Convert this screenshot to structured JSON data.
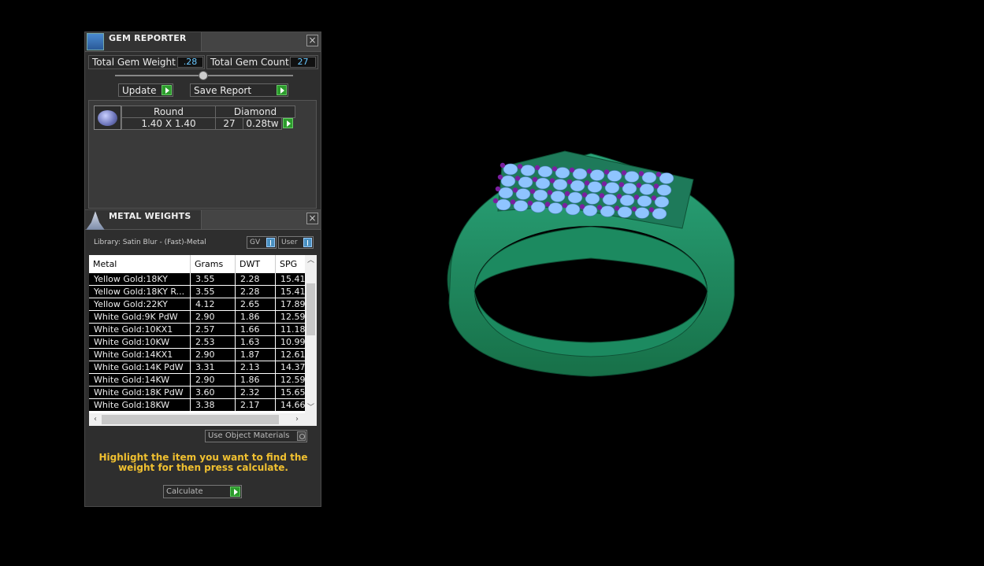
{
  "gem_reporter": {
    "title": "GEM REPORTER",
    "close": "×",
    "total_weight_label": "Total Gem Weight",
    "total_weight_value": ".28",
    "total_count_label": "Total Gem Count",
    "total_count_value": "27",
    "update_label": "Update",
    "save_report_label": "Save Report",
    "gem": {
      "shape": "Round",
      "material": "Diamond",
      "size": "1.40 X 1.40",
      "count": "27",
      "weight": "0.28tw"
    }
  },
  "metal_weights": {
    "title": "METAL WEIGHTS",
    "close": "×",
    "library": "Library: Satin Blur - (Fast)-Metal",
    "gv_label": "GV",
    "user_label": "User",
    "columns": [
      "Metal",
      "Grams",
      "DWT",
      "SPG"
    ],
    "rows": [
      [
        "Yellow Gold:18KY",
        "3.55",
        "2.28",
        "15.41"
      ],
      [
        "Yellow Gold:18KY R...",
        "3.55",
        "2.28",
        "15.41"
      ],
      [
        "Yellow Gold:22KY",
        "4.12",
        "2.65",
        "17.89"
      ],
      [
        "White Gold:9K PdW",
        "2.90",
        "1.86",
        "12.59"
      ],
      [
        "White Gold:10KX1",
        "2.57",
        "1.66",
        "11.18"
      ],
      [
        "White Gold:10KW",
        "2.53",
        "1.63",
        "10.99"
      ],
      [
        "White Gold:14KX1",
        "2.90",
        "1.87",
        "12.61"
      ],
      [
        "White Gold:14K PdW",
        "3.31",
        "2.13",
        "14.37"
      ],
      [
        "White Gold:14KW",
        "2.90",
        "1.86",
        "12.59"
      ],
      [
        "White Gold:18K PdW",
        "3.60",
        "2.32",
        "15.65"
      ],
      [
        "White Gold:18KW",
        "3.38",
        "2.17",
        "14.66"
      ]
    ],
    "use_object_materials": "Use Object Materials",
    "hint": "Highlight the item you want to find the weight for then press calculate.",
    "calculate_label": "Calculate"
  },
  "colors": {
    "ring_green": "#1f8a5e",
    "gem_blue": "#8fc4ff",
    "prong_purple": "#7a1fa0",
    "hint_yellow": "#f0c030",
    "value_cyan": "#6ac8ff"
  }
}
